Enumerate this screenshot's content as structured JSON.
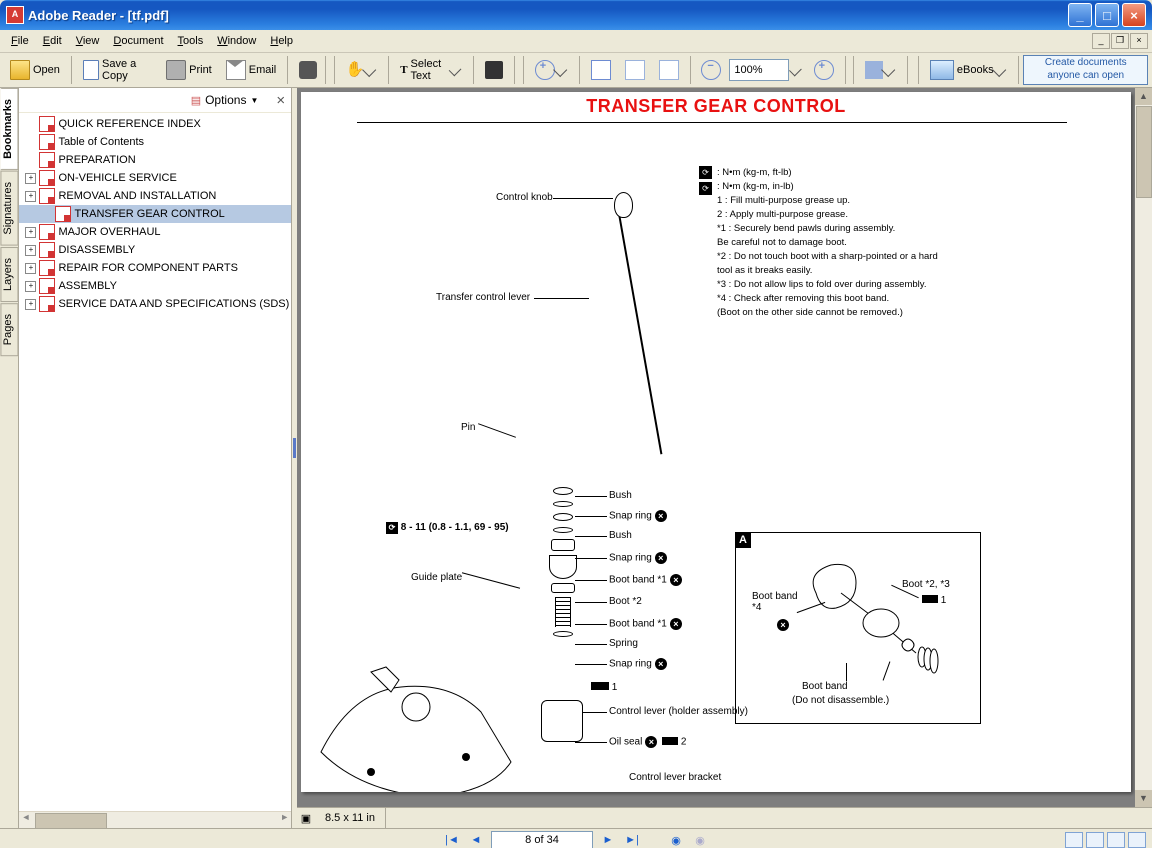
{
  "window": {
    "title": "Adobe Reader - [tf.pdf]"
  },
  "menu": {
    "items": [
      "File",
      "Edit",
      "View",
      "Document",
      "Tools",
      "Window",
      "Help"
    ]
  },
  "toolbar": {
    "open": "Open",
    "save": "Save a Copy",
    "print": "Print",
    "email": "Email",
    "selecttext": "Select Text",
    "zoom_value": "100%",
    "ebooks": "eBooks",
    "promo_line1": "Create documents",
    "promo_line2": "anyone can open"
  },
  "sidetabs": [
    "Bookmarks",
    "Signatures",
    "Layers",
    "Pages"
  ],
  "bookmarks": {
    "options_label": "Options",
    "items": [
      {
        "expand": false,
        "label": "QUICK REFERENCE INDEX"
      },
      {
        "expand": false,
        "label": "Table of Contents"
      },
      {
        "expand": false,
        "label": "PREPARATION"
      },
      {
        "expand": true,
        "label": "ON-VEHICLE SERVICE"
      },
      {
        "expand": true,
        "label": "REMOVAL AND INSTALLATION"
      },
      {
        "expand": false,
        "label": "TRANSFER GEAR CONTROL",
        "indent": 1,
        "selected": true
      },
      {
        "expand": true,
        "label": "MAJOR OVERHAUL"
      },
      {
        "expand": true,
        "label": "DISASSEMBLY"
      },
      {
        "expand": true,
        "label": "REPAIR FOR COMPONENT PARTS"
      },
      {
        "expand": true,
        "label": "ASSEMBLY"
      },
      {
        "expand": true,
        "label": "SERVICE DATA AND SPECIFICATIONS (SDS)"
      }
    ]
  },
  "document": {
    "title": "TRANSFER GEAR CONTROL",
    "legend": [
      "N•m  (kg-m,  ft-lb)",
      "N•m  (kg-m,  in-lb)",
      "1 : Fill multi-purpose grease up.",
      "2 : Apply multi-purpose grease.",
      "*1 : Securely bend pawls during assembly.",
      "       Be careful not to damage boot.",
      "*2 : Do not touch boot with a sharp-pointed or a hard",
      "       tool as it breaks easily.",
      "*3 : Do not allow lips to fold over during assembly.",
      "*4 : Check after removing this boot band.",
      "       (Boot on the other side cannot be removed.)"
    ],
    "callouts": {
      "control_knob": "Control knob",
      "transfer_lever": "Transfer control lever",
      "pin": "Pin",
      "torque": "8 - 11 (0.8 - 1.1, 69 - 95)",
      "guide_plate": "Guide plate",
      "bush1": "Bush",
      "snap1": "Snap ring",
      "bush2": "Bush",
      "snap2": "Snap ring",
      "bootband1": "Boot band *1",
      "boot2": "Boot *2",
      "bootband2": "Boot band *1",
      "spring": "Spring",
      "snap3": "Snap ring",
      "g1": "1",
      "control_lever_holder": "Control lever (holder assembly)",
      "oilseal": "Oil seal",
      "oilseal_tag": "2",
      "control_bracket": "Control lever bracket"
    },
    "detailA": {
      "label": "A",
      "boot_band_star4": "Boot band\n*4",
      "boot_23": "Boot *2, *3",
      "one": "1",
      "boot_band_nodis": "Boot band",
      "nodis": "(Do not disassemble.)"
    }
  },
  "status": {
    "page_dims": "8.5 x 11 in"
  },
  "nav": {
    "page_field": "8 of 34"
  }
}
